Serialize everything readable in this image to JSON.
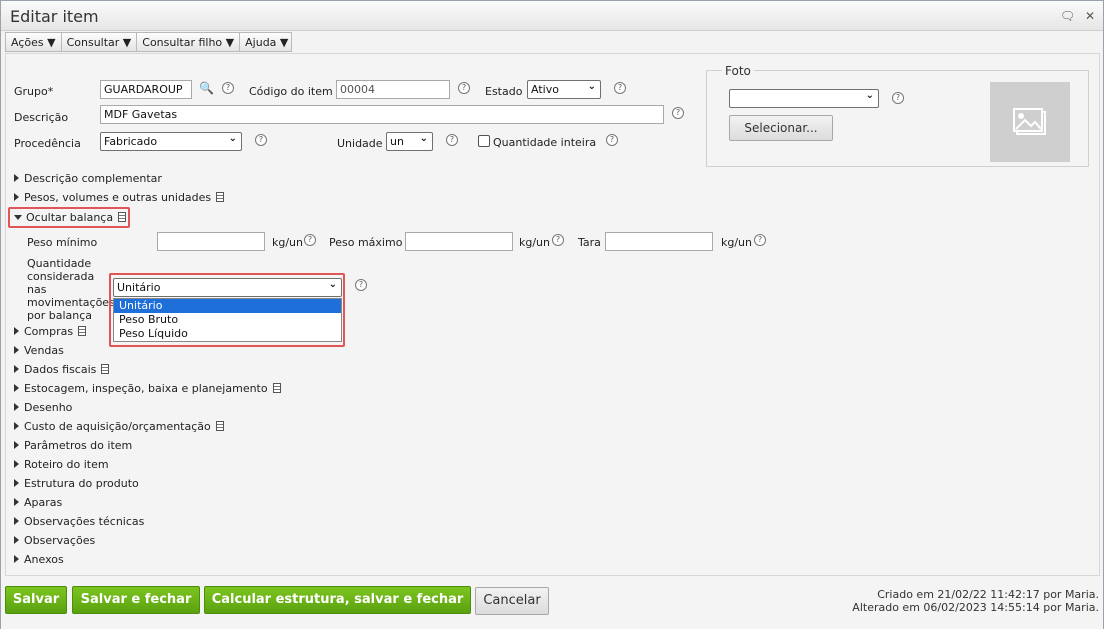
{
  "window": {
    "title": "Editar item"
  },
  "toolbar": {
    "items": [
      "Ações",
      "Consultar",
      "Consultar filho",
      "Ajuda"
    ]
  },
  "form": {
    "grupo_label": "Grupo*",
    "grupo_value": "GUARDAROUP",
    "codigo_label": "Código do item",
    "codigo_value": "00004",
    "estado_label": "Estado",
    "estado_value": "Ativo",
    "descricao_label": "Descrição",
    "descricao_value": "MDF Gavetas",
    "procedencia_label": "Procedência",
    "procedencia_value": "Fabricado",
    "unidade_label": "Unidade",
    "unidade_value": "un",
    "quantidade_inteira_label": "Quantidade inteira"
  },
  "foto": {
    "legend": "Foto",
    "select_value": "",
    "button_label": "Selecionar..."
  },
  "sections": [
    "Descrição complementar",
    "Pesos, volumes e outras unidades",
    "Ocultar balança",
    "Compras",
    "Vendas",
    "Dados fiscais",
    "Estocagem, inspeção, baixa e planejamento",
    "Desenho",
    "Custo de aquisição/orçamentação",
    "Parâmetros do item",
    "Roteiro do item",
    "Estrutura do produto",
    "Aparas",
    "Observações técnicas",
    "Observações",
    "Anexos"
  ],
  "balanca": {
    "peso_minimo_label": "Peso mínimo",
    "peso_maximo_label": "Peso máximo",
    "tara_label": "Tara",
    "unit": "kg/un",
    "quantidade_label_lines": [
      "Quantidade",
      "considerada",
      "nas",
      "movimentações",
      "por balança"
    ],
    "quantidade_value": "Unitário",
    "options": [
      "Unitário",
      "Peso Bruto",
      "Peso Líquido"
    ]
  },
  "actions": {
    "salvar": "Salvar",
    "salvar_fechar": "Salvar e fechar",
    "calcular": "Calcular estrutura, salvar e fechar",
    "cancelar": "Cancelar"
  },
  "footer": {
    "criado": "Criado em 21/02/22 11:42:17 por Maria.",
    "alterado": "Alterado em 06/02/2023 14:55:14 por Maria."
  },
  "colors": {
    "accent_green": "#6ab417",
    "highlight_red": "#e05555",
    "selection_blue": "#1e6fd9"
  }
}
